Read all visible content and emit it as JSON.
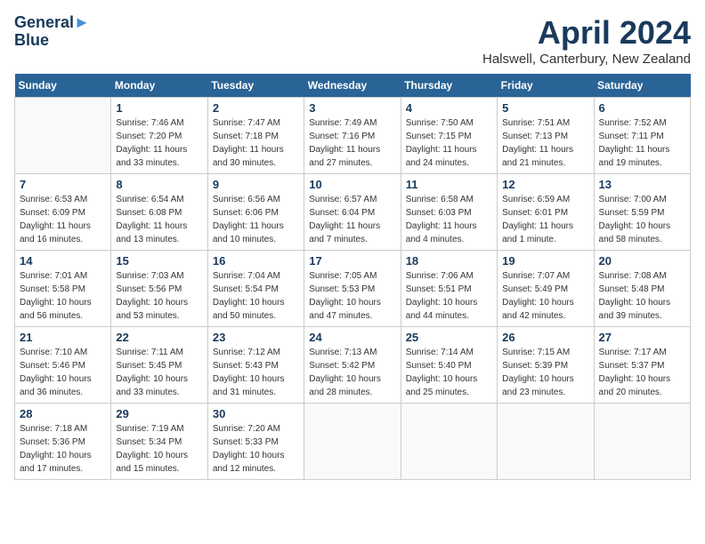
{
  "header": {
    "logo_line1": "General",
    "logo_line2": "Blue",
    "month": "April 2024",
    "location": "Halswell, Canterbury, New Zealand"
  },
  "days_of_week": [
    "Sunday",
    "Monday",
    "Tuesday",
    "Wednesday",
    "Thursday",
    "Friday",
    "Saturday"
  ],
  "weeks": [
    [
      {
        "day": "",
        "sunrise": "",
        "sunset": "",
        "daylight": ""
      },
      {
        "day": "1",
        "sunrise": "Sunrise: 7:46 AM",
        "sunset": "Sunset: 7:20 PM",
        "daylight": "Daylight: 11 hours and 33 minutes."
      },
      {
        "day": "2",
        "sunrise": "Sunrise: 7:47 AM",
        "sunset": "Sunset: 7:18 PM",
        "daylight": "Daylight: 11 hours and 30 minutes."
      },
      {
        "day": "3",
        "sunrise": "Sunrise: 7:49 AM",
        "sunset": "Sunset: 7:16 PM",
        "daylight": "Daylight: 11 hours and 27 minutes."
      },
      {
        "day": "4",
        "sunrise": "Sunrise: 7:50 AM",
        "sunset": "Sunset: 7:15 PM",
        "daylight": "Daylight: 11 hours and 24 minutes."
      },
      {
        "day": "5",
        "sunrise": "Sunrise: 7:51 AM",
        "sunset": "Sunset: 7:13 PM",
        "daylight": "Daylight: 11 hours and 21 minutes."
      },
      {
        "day": "6",
        "sunrise": "Sunrise: 7:52 AM",
        "sunset": "Sunset: 7:11 PM",
        "daylight": "Daylight: 11 hours and 19 minutes."
      }
    ],
    [
      {
        "day": "7",
        "sunrise": "Sunrise: 6:53 AM",
        "sunset": "Sunset: 6:09 PM",
        "daylight": "Daylight: 11 hours and 16 minutes."
      },
      {
        "day": "8",
        "sunrise": "Sunrise: 6:54 AM",
        "sunset": "Sunset: 6:08 PM",
        "daylight": "Daylight: 11 hours and 13 minutes."
      },
      {
        "day": "9",
        "sunrise": "Sunrise: 6:56 AM",
        "sunset": "Sunset: 6:06 PM",
        "daylight": "Daylight: 11 hours and 10 minutes."
      },
      {
        "day": "10",
        "sunrise": "Sunrise: 6:57 AM",
        "sunset": "Sunset: 6:04 PM",
        "daylight": "Daylight: 11 hours and 7 minutes."
      },
      {
        "day": "11",
        "sunrise": "Sunrise: 6:58 AM",
        "sunset": "Sunset: 6:03 PM",
        "daylight": "Daylight: 11 hours and 4 minutes."
      },
      {
        "day": "12",
        "sunrise": "Sunrise: 6:59 AM",
        "sunset": "Sunset: 6:01 PM",
        "daylight": "Daylight: 11 hours and 1 minute."
      },
      {
        "day": "13",
        "sunrise": "Sunrise: 7:00 AM",
        "sunset": "Sunset: 5:59 PM",
        "daylight": "Daylight: 10 hours and 58 minutes."
      }
    ],
    [
      {
        "day": "14",
        "sunrise": "Sunrise: 7:01 AM",
        "sunset": "Sunset: 5:58 PM",
        "daylight": "Daylight: 10 hours and 56 minutes."
      },
      {
        "day": "15",
        "sunrise": "Sunrise: 7:03 AM",
        "sunset": "Sunset: 5:56 PM",
        "daylight": "Daylight: 10 hours and 53 minutes."
      },
      {
        "day": "16",
        "sunrise": "Sunrise: 7:04 AM",
        "sunset": "Sunset: 5:54 PM",
        "daylight": "Daylight: 10 hours and 50 minutes."
      },
      {
        "day": "17",
        "sunrise": "Sunrise: 7:05 AM",
        "sunset": "Sunset: 5:53 PM",
        "daylight": "Daylight: 10 hours and 47 minutes."
      },
      {
        "day": "18",
        "sunrise": "Sunrise: 7:06 AM",
        "sunset": "Sunset: 5:51 PM",
        "daylight": "Daylight: 10 hours and 44 minutes."
      },
      {
        "day": "19",
        "sunrise": "Sunrise: 7:07 AM",
        "sunset": "Sunset: 5:49 PM",
        "daylight": "Daylight: 10 hours and 42 minutes."
      },
      {
        "day": "20",
        "sunrise": "Sunrise: 7:08 AM",
        "sunset": "Sunset: 5:48 PM",
        "daylight": "Daylight: 10 hours and 39 minutes."
      }
    ],
    [
      {
        "day": "21",
        "sunrise": "Sunrise: 7:10 AM",
        "sunset": "Sunset: 5:46 PM",
        "daylight": "Daylight: 10 hours and 36 minutes."
      },
      {
        "day": "22",
        "sunrise": "Sunrise: 7:11 AM",
        "sunset": "Sunset: 5:45 PM",
        "daylight": "Daylight: 10 hours and 33 minutes."
      },
      {
        "day": "23",
        "sunrise": "Sunrise: 7:12 AM",
        "sunset": "Sunset: 5:43 PM",
        "daylight": "Daylight: 10 hours and 31 minutes."
      },
      {
        "day": "24",
        "sunrise": "Sunrise: 7:13 AM",
        "sunset": "Sunset: 5:42 PM",
        "daylight": "Daylight: 10 hours and 28 minutes."
      },
      {
        "day": "25",
        "sunrise": "Sunrise: 7:14 AM",
        "sunset": "Sunset: 5:40 PM",
        "daylight": "Daylight: 10 hours and 25 minutes."
      },
      {
        "day": "26",
        "sunrise": "Sunrise: 7:15 AM",
        "sunset": "Sunset: 5:39 PM",
        "daylight": "Daylight: 10 hours and 23 minutes."
      },
      {
        "day": "27",
        "sunrise": "Sunrise: 7:17 AM",
        "sunset": "Sunset: 5:37 PM",
        "daylight": "Daylight: 10 hours and 20 minutes."
      }
    ],
    [
      {
        "day": "28",
        "sunrise": "Sunrise: 7:18 AM",
        "sunset": "Sunset: 5:36 PM",
        "daylight": "Daylight: 10 hours and 17 minutes."
      },
      {
        "day": "29",
        "sunrise": "Sunrise: 7:19 AM",
        "sunset": "Sunset: 5:34 PM",
        "daylight": "Daylight: 10 hours and 15 minutes."
      },
      {
        "day": "30",
        "sunrise": "Sunrise: 7:20 AM",
        "sunset": "Sunset: 5:33 PM",
        "daylight": "Daylight: 10 hours and 12 minutes."
      },
      {
        "day": "",
        "sunrise": "",
        "sunset": "",
        "daylight": ""
      },
      {
        "day": "",
        "sunrise": "",
        "sunset": "",
        "daylight": ""
      },
      {
        "day": "",
        "sunrise": "",
        "sunset": "",
        "daylight": ""
      },
      {
        "day": "",
        "sunrise": "",
        "sunset": "",
        "daylight": ""
      }
    ]
  ]
}
